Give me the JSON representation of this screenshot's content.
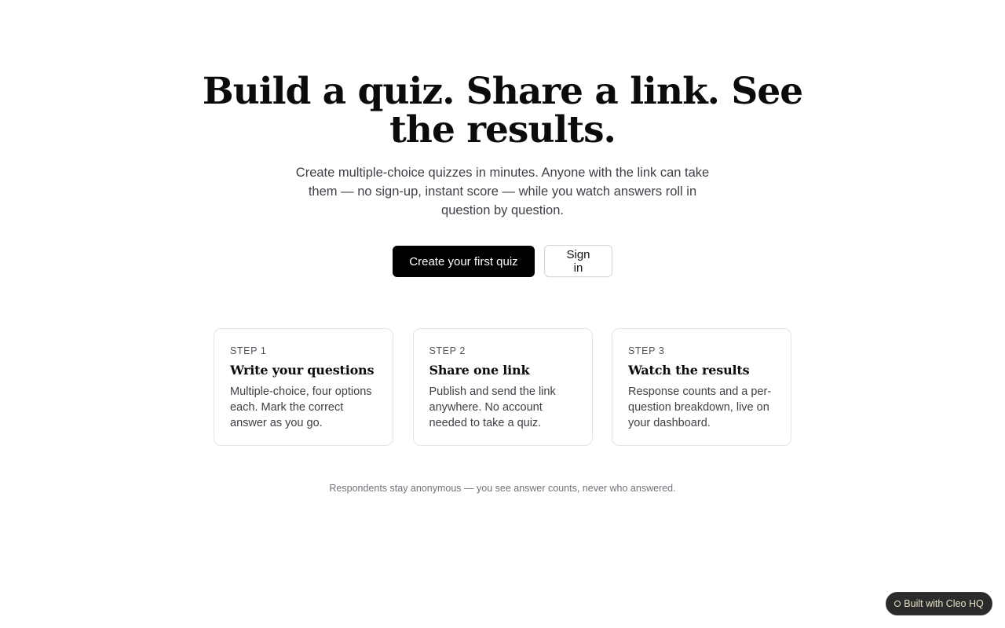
{
  "hero": {
    "title": "Build a quiz. Share a link. See the results.",
    "subtitle": "Create multiple-choice quizzes in minutes. Anyone with the link can take them — no sign-up, instant score — while you watch answers roll in question by question."
  },
  "cta": {
    "primary_label": "Create your first quiz",
    "secondary_label": "Sign in"
  },
  "steps": [
    {
      "step": "STEP 1",
      "title": "Write your questions",
      "body": "Multiple-choice, four options each. Mark the correct answer as you go."
    },
    {
      "step": "STEP 2",
      "title": "Share one link",
      "body": "Publish and send the link anywhere. No account needed to take a quiz."
    },
    {
      "step": "STEP 3",
      "title": "Watch the results",
      "body": "Response counts and a per-question breakdown, live on your dashboard."
    }
  ],
  "footer": {
    "privacy_note": "Respondents stay anonymous — you see answer counts, never who answered."
  },
  "badge": {
    "label": "Built with Cleo HQ",
    "icon": "circle-outline-icon"
  },
  "colors": {
    "primary_button": "#000000",
    "badge_background": "#2b2b2b",
    "badge_text": "#e7e2c8"
  }
}
